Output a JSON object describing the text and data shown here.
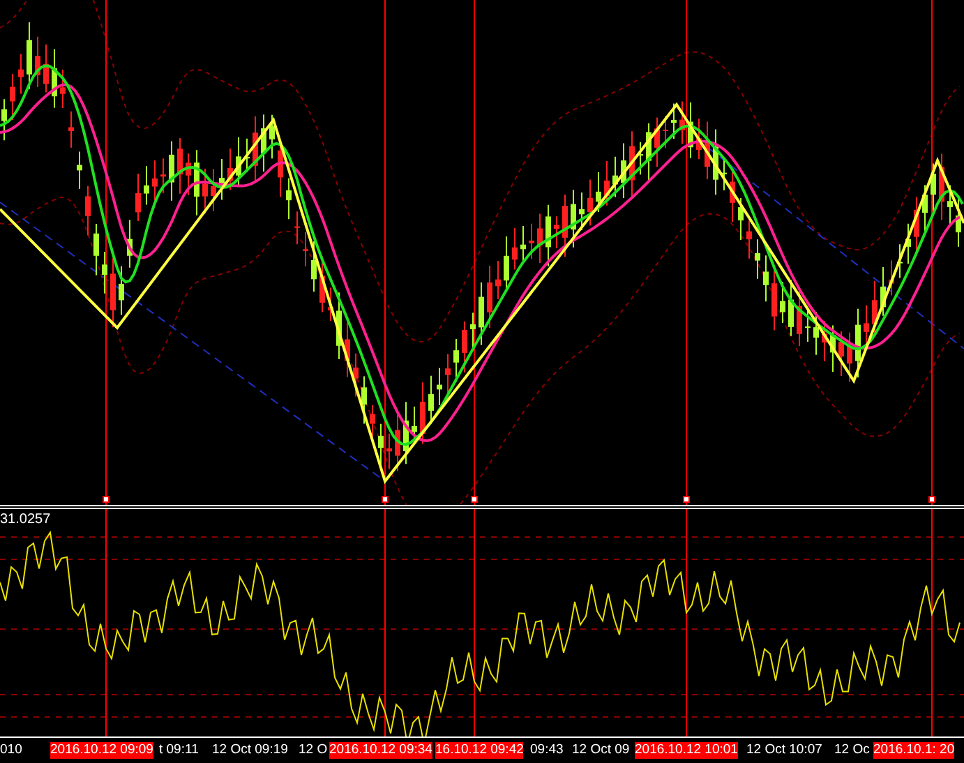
{
  "indicator_pane": {
    "value_label": "31.0257"
  },
  "time_axis": {
    "labels": [
      {
        "text": "010",
        "highlighted": false
      },
      {
        "text": "2016.10.12 09:09",
        "highlighted": true
      },
      {
        "text": "t 09:11",
        "highlighted": false
      },
      {
        "text": "12 Oct 09:19",
        "highlighted": false
      },
      {
        "text": "12 O",
        "highlighted": false
      },
      {
        "text": "2016.10.12 09:34",
        "highlighted": true
      },
      {
        "text": "16.10.12 09:42",
        "highlighted": true
      },
      {
        "text": "09:43",
        "highlighted": false
      },
      {
        "text": "12 Oct 09",
        "highlighted": false
      },
      {
        "text": "2016.10.12 10:01",
        "highlighted": true
      },
      {
        "text": "12 Oct 10:07",
        "highlighted": false
      },
      {
        "text": "12 Oc",
        "highlighted": false
      },
      {
        "text": "2016.10.1: 20",
        "highlighted": true
      }
    ]
  }
}
